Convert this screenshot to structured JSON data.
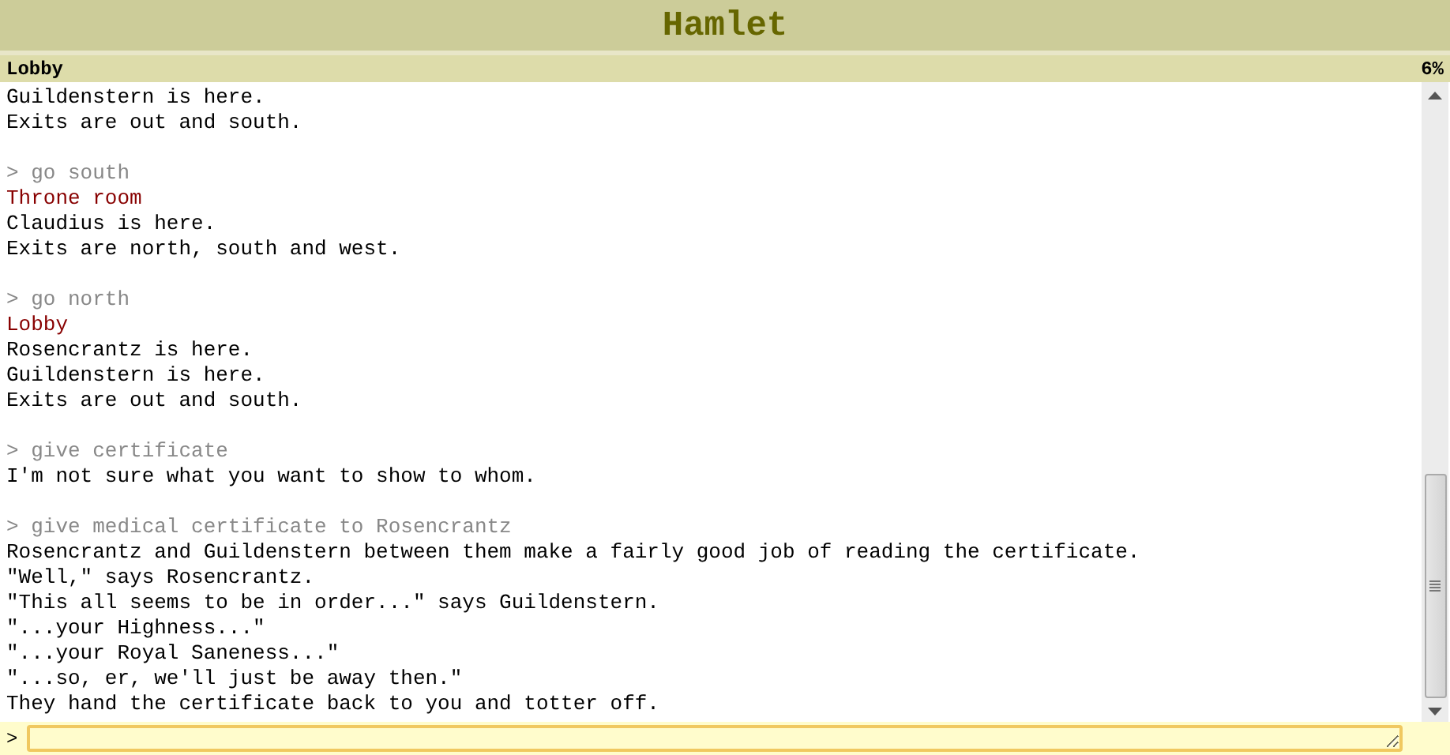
{
  "window": {
    "title": "Hamlet"
  },
  "status_bar": {
    "location": "Lobby",
    "score": "6%"
  },
  "transcript": [
    {
      "kind": "text",
      "text": "Guildenstern is here."
    },
    {
      "kind": "text",
      "text": "Exits are out and south."
    },
    {
      "kind": "command",
      "text": "> go south"
    },
    {
      "kind": "room",
      "text": "Throne room"
    },
    {
      "kind": "text",
      "text": "Claudius is here."
    },
    {
      "kind": "text",
      "text": "Exits are north, south and west."
    },
    {
      "kind": "command",
      "text": "> go north"
    },
    {
      "kind": "room",
      "text": "Lobby"
    },
    {
      "kind": "text",
      "text": "Rosencrantz is here."
    },
    {
      "kind": "text",
      "text": "Guildenstern is here."
    },
    {
      "kind": "text",
      "text": "Exits are out and south."
    },
    {
      "kind": "command",
      "text": "> give certificate"
    },
    {
      "kind": "text",
      "text": "I'm not sure what you want to show to whom."
    },
    {
      "kind": "command",
      "text": "> give medical certificate to Rosencrantz"
    },
    {
      "kind": "text",
      "text": "Rosencrantz and Guildenstern between them make a fairly good job of reading the certificate."
    },
    {
      "kind": "text",
      "text": "\"Well,\" says Rosencrantz."
    },
    {
      "kind": "text",
      "text": "\"This all seems to be in order...\" says Guildenstern."
    },
    {
      "kind": "text",
      "text": "\"...your Highness...\""
    },
    {
      "kind": "text",
      "text": "\"...your Royal Saneness...\""
    },
    {
      "kind": "text",
      "text": "\"...so, er, we'll just be away then.\""
    },
    {
      "kind": "text",
      "text": "They hand the certificate back to you and totter off."
    }
  ],
  "input": {
    "prompt": ">"
  }
}
